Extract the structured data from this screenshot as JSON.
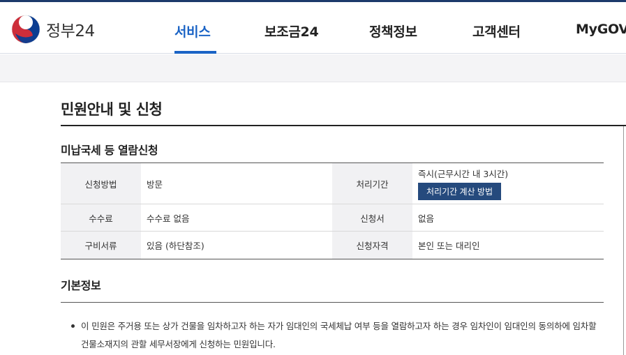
{
  "header": {
    "logo_text": "정부24",
    "nav": [
      {
        "label": "서비스",
        "active": true
      },
      {
        "label": "보조금24",
        "active": false
      },
      {
        "label": "정책정보",
        "active": false
      },
      {
        "label": "고객센터",
        "active": false
      },
      {
        "label": "MyGOV",
        "active": false
      }
    ]
  },
  "page": {
    "title": "민원안내 및 신청",
    "service_title": "미납국세 등 열람신청",
    "table": {
      "rows": [
        {
          "h1": "신청방법",
          "v1": "방문",
          "h2": "처리기간",
          "v2": "즉시(근무시간 내 3시간)",
          "button": "처리기간 계산 방법"
        },
        {
          "h1": "수수료",
          "v1": "수수료 없음",
          "h2": "신청서",
          "v2": "없음"
        },
        {
          "h1": "구비서류",
          "v1": "있음 (하단참조)",
          "h2": "신청자격",
          "v2": "본인 또는 대리인"
        }
      ]
    },
    "basic_info_title": "기본정보",
    "description": "이 민원은 주거용 또는 상가 건물을 임차하고자 하는 자가 임대인의 국세체납 여부 등을 열람하고자 하는 경우 임차인이 임대인의 동의하에 임차할 건물소재지의 관할 세무서장에게 신청하는 민원입니다."
  },
  "colors": {
    "accent": "#1a63c5",
    "button_bg": "#254a7d",
    "top_line": "#1c3a6b"
  }
}
